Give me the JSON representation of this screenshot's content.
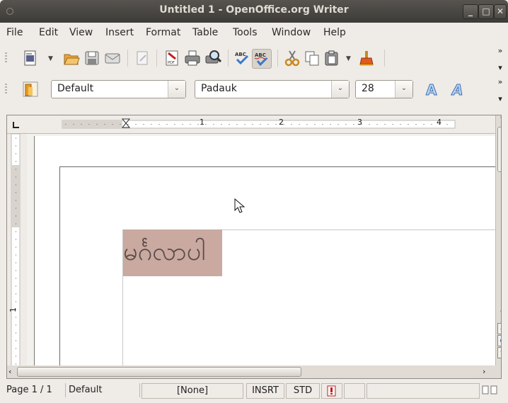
{
  "window": {
    "title": "Untitled 1 - OpenOffice.org Writer",
    "minimize": "_",
    "maximize": "□",
    "close": "✕"
  },
  "menu": [
    "File",
    "Edit",
    "View",
    "Insert",
    "Format",
    "Table",
    "Tools",
    "Window",
    "Help"
  ],
  "formatting": {
    "style_value": "Default",
    "font_value": "Padauk",
    "size_value": "28"
  },
  "ruler": {
    "marks": [
      "1",
      "2",
      "3",
      "4"
    ],
    "vertical_mark": "1"
  },
  "document": {
    "text": "မင်္ဂလာပါ"
  },
  "status": {
    "page": "Page 1 / 1",
    "style": "Default",
    "language": "[None]",
    "insert_mode": "INSRT",
    "selection_mode": "STD"
  },
  "colors": {
    "selection": "#c9a9a0",
    "titlebar": "#3c3b37",
    "accent": "#e05a1d"
  }
}
